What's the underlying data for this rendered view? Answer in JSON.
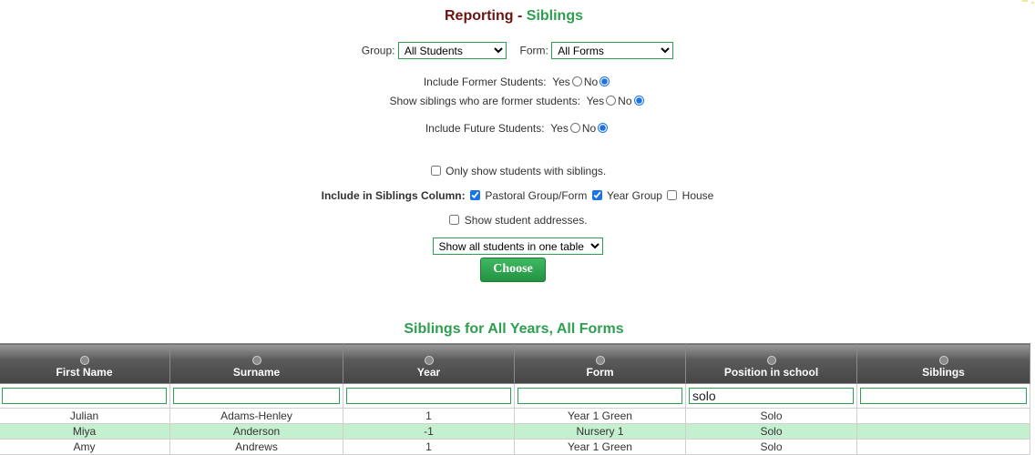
{
  "title": {
    "prefix": "Reporting - ",
    "highlight": "Siblings"
  },
  "filters": {
    "group_label": "Group:",
    "group_value": "All Students",
    "form_label": "Form:",
    "form_value": "All Forms"
  },
  "options": {
    "former_label": "Include Former Students:",
    "siblings_former_label": "Show siblings who are former students:",
    "future_label": "Include Future Students:",
    "yes": "Yes",
    "no": "No",
    "only_siblings_label": "Only show students with siblings.",
    "include_col_label": "Include in Siblings Column:",
    "pastoral_label": "Pastoral Group/Form",
    "year_group_label": "Year Group",
    "house_label": "House",
    "addresses_label": "Show student addresses.",
    "table_mode_value": "Show all students in one table"
  },
  "choose_label": "Choose",
  "subtitle": "Siblings for All Years, All Forms",
  "table": {
    "columns": [
      "First Name",
      "Surname",
      "Year",
      "Form",
      "Position in school",
      "Siblings"
    ],
    "filter_values": [
      "",
      "",
      "",
      "",
      "solo",
      ""
    ],
    "rows": [
      {
        "first": "Julian",
        "surname": "Adams-Henley",
        "year": "1",
        "form": "Year 1 Green",
        "position": "Solo",
        "siblings": ""
      },
      {
        "first": "Miya",
        "surname": "Anderson",
        "year": "-1",
        "form": "Nursery 1",
        "position": "Solo",
        "siblings": ""
      },
      {
        "first": "Amy",
        "surname": "Andrews",
        "year": "1",
        "form": "Year 1 Green",
        "position": "Solo",
        "siblings": ""
      }
    ]
  },
  "colors": {
    "accent": "#2e9e4f",
    "title_dark": "#6b1414",
    "row_alt": "#c4f0d0"
  }
}
